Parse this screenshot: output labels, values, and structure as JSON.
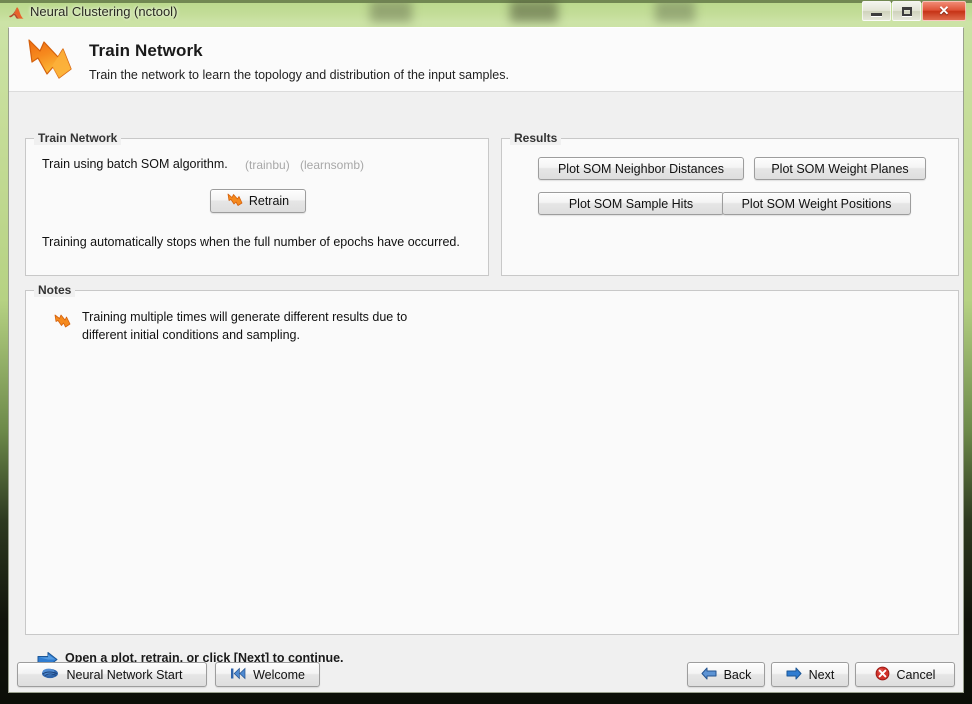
{
  "window": {
    "title": "Neural Clustering (nctool)",
    "title_icon": "matlab-membrane-icon",
    "controls": {
      "minimize": "minimize-button",
      "maximize": "maximize-button",
      "close_glyph": "✕"
    }
  },
  "header": {
    "icon": "orange-lightning-arrow-icon",
    "title": "Train Network",
    "subtitle": "Train the network to learn the topology and distribution of the input samples."
  },
  "train_panel": {
    "legend": "Train Network",
    "description": "Train using batch SOM algorithm.",
    "function_1": "(trainbu)",
    "function_2": "(learnsomb)",
    "retrain_button": "Retrain",
    "retrain_icon": "orange-lightning-arrow-icon",
    "note": "Training automatically stops when the full number of epochs have occurred."
  },
  "results_panel": {
    "legend": "Results",
    "buttons": [
      {
        "label": "Plot SOM Neighbor Distances",
        "name": "plot-som-neighbor-distances-button"
      },
      {
        "label": "Plot SOM Weight Planes",
        "name": "plot-som-weight-planes-button"
      },
      {
        "label": "Plot SOM Sample Hits",
        "name": "plot-som-sample-hits-button"
      },
      {
        "label": "Plot SOM Weight Positions",
        "name": "plot-som-weight-positions-button"
      }
    ]
  },
  "notes_panel": {
    "legend": "Notes",
    "icon": "orange-lightning-arrow-icon",
    "text": "Training multiple times will generate different results due to different initial conditions and sampling."
  },
  "status": {
    "icon": "blue-right-arrow-icon",
    "message": "Open a plot, retrain, or click [Next] to continue."
  },
  "footer": {
    "neural_network_start": "Neural Network Start",
    "neural_network_start_icon": "blue-brain-icon",
    "welcome": "Welcome",
    "welcome_icon": "skip-back-icon",
    "back": "Back",
    "back_icon": "blue-left-arrow-icon",
    "next": "Next",
    "next_icon": "blue-right-arrow-icon",
    "cancel": "Cancel",
    "cancel_icon": "red-error-icon"
  },
  "colors": {
    "titlebar_green": "#c6dd99",
    "accent_orange": "#f58220",
    "accent_blue": "#2b6fc4",
    "close_red": "#c63316",
    "dialog_bg": "#f0f0f0",
    "panel_bg": "#fafafa"
  }
}
